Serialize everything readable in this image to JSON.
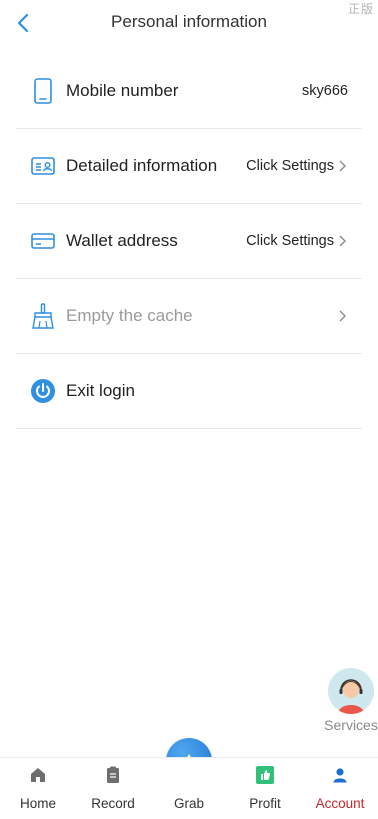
{
  "header": {
    "title": "Personal information",
    "corner_mark": "正版"
  },
  "list": [
    {
      "icon": "phone-icon",
      "label": "Mobile number",
      "value": "sky666",
      "has_chevron": false
    },
    {
      "icon": "id-card-icon",
      "label": "Detailed information",
      "value": "Click Settings",
      "has_chevron": true
    },
    {
      "icon": "wallet-card-icon",
      "label": "Wallet address",
      "value": "Click Settings",
      "has_chevron": true
    },
    {
      "icon": "broom-icon",
      "label": "Empty the cache",
      "value": "",
      "has_chevron": true
    },
    {
      "icon": "power-icon",
      "label": "Exit login",
      "value": "",
      "has_chevron": false
    }
  ],
  "services": {
    "label": "Services"
  },
  "tabbar": {
    "home": "Home",
    "record": "Record",
    "grab": "Grab",
    "profit": "Profit",
    "account": "Account",
    "active": "account"
  },
  "colors": {
    "accent_blue": "#2f8fe0",
    "active_red": "#c2292a",
    "profit_green": "#2fc07a"
  }
}
